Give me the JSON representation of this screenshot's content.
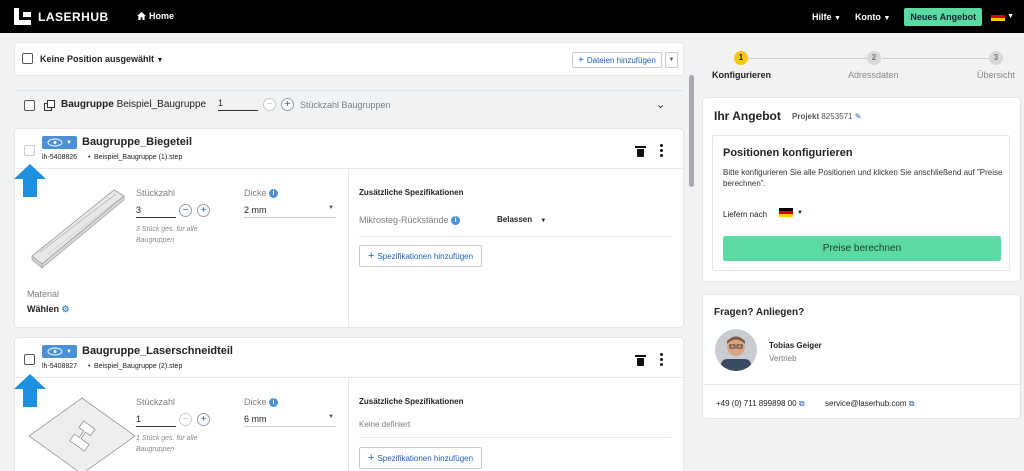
{
  "nav": {
    "logo": "LASERHUB",
    "home": "Home",
    "help": "Hilfe",
    "account": "Konto",
    "new_offer": "Neues Angebot"
  },
  "toolbar": {
    "selection": "Keine Position ausgewählt",
    "add_files": "Dateien hinzufügen"
  },
  "assembly": {
    "label_bold": "Baugruppe",
    "label_name": "Beispiel_Baugruppe",
    "qty": "1",
    "qty_label": "Stückzahl Baugruppen"
  },
  "positions": [
    {
      "title": "Baugruppe_Biegeteil",
      "id": "lh-5408826",
      "file": "Beispiel_Baugruppe (1).step",
      "qty_label": "Stückzahl",
      "qty": "3",
      "qty_hint": "3 Stück ges. für alle Baugruppen",
      "thickness_label": "Dicke",
      "thickness": "2 mm",
      "material_label": "Material",
      "material_value": "Wählen",
      "spec_title": "Zusätzliche Spezifikationen",
      "spec_row_label": "Mikrosteg-Rückstände",
      "spec_row_value": "Belassen",
      "spec_add": "Spezifikationen hinzufügen"
    },
    {
      "title": "Baugruppe_Laserschneidteil",
      "id": "lh-5408827",
      "file": "Beispiel_Baugruppe (2).step",
      "qty_label": "Stückzahl",
      "qty": "1",
      "qty_hint": "1 Stück ges. für alle Baugruppen",
      "thickness_label": "Dicke",
      "thickness": "6 mm",
      "spec_title": "Zusätzliche Spezifikationen",
      "spec_none": "Keine definiert",
      "spec_add": "Spezifikationen hinzufügen"
    }
  ],
  "steps": [
    {
      "num": "1",
      "label": "Konfigurieren",
      "active": true
    },
    {
      "num": "2",
      "label": "Adressdaten",
      "active": false
    },
    {
      "num": "3",
      "label": "Übersicht",
      "active": false
    }
  ],
  "offer": {
    "title": "Ihr Angebot",
    "project_label": "Projekt",
    "project_number": "8253571",
    "box_title": "Positionen konfigurieren",
    "box_text": "Bitte konfigurieren Sie alle Positionen und klicken Sie anschließend auf \"Preise berechnen\".",
    "deliver_label": "Liefern nach",
    "calc_button": "Preise berechnen"
  },
  "contact": {
    "title": "Fragen? Anliegen?",
    "name": "Tobias Geiger",
    "role": "Vertrieb",
    "phone": "+49 (0) 711 899898 00",
    "email": "service@laserhub.com"
  },
  "colors": {
    "accent_green": "#5bdba3",
    "step_active": "#f5c518",
    "link_blue": "#1d5fbf",
    "hint_arrow": "#1e90e0"
  }
}
